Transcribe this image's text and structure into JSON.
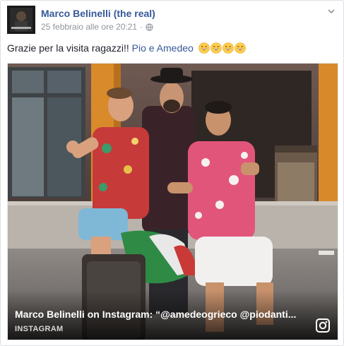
{
  "post": {
    "author": "Marco Belinelli (the real)",
    "timestamp": "25 febbraio alle ore 20:21",
    "separator": "·",
    "privacy_icon": "globe-icon",
    "options_icon": "chevron-down-icon",
    "text_prefix": "Grazie per la visita ragazzi!! ",
    "mention": "Pio e Amedeo",
    "emojis": [
      "grinning-emoji",
      "grinning-emoji",
      "grinning-emoji",
      "grinning-emoji"
    ]
  },
  "attachment": {
    "title": "Marco Belinelli on Instagram: “@amedeogrieco @piodanti...",
    "source": "INSTAGRAM",
    "source_icon": "instagram-icon"
  },
  "colors": {
    "link": "#365899",
    "meta": "#90949c",
    "text": "#1d2129"
  }
}
